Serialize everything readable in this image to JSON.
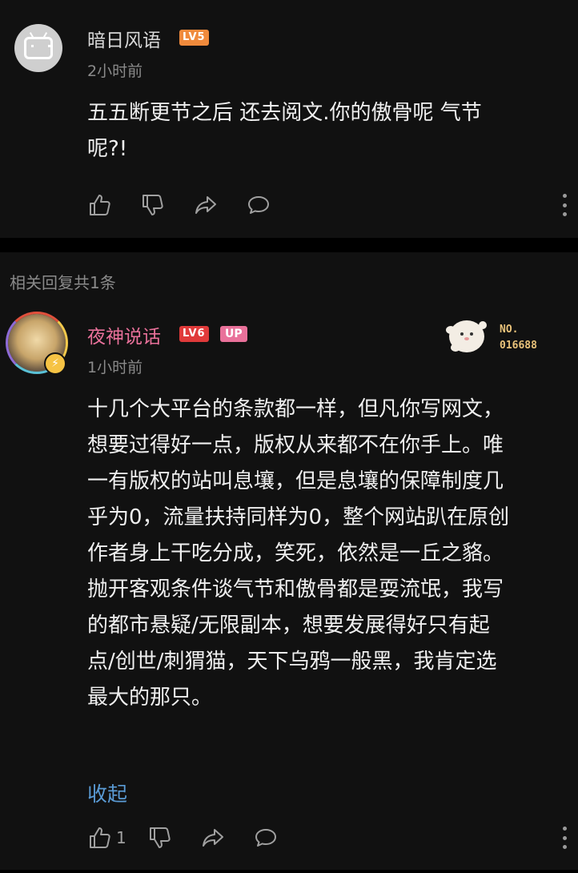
{
  "comment1": {
    "username": "暗日风语",
    "level": "LV5",
    "level_color": "#f08a3c",
    "time": "2小时前",
    "content": "五五断更节之后 还去阅文.你的傲骨呢 气节\n呢?!",
    "avatar_icon": "tv-icon"
  },
  "related": {
    "header": "相关回复共1条"
  },
  "comment2": {
    "username": "夜神说话",
    "username_color": "#e9719a",
    "level": "LV6",
    "level_color": "#e03a3a",
    "up_badge": "UP",
    "time": "1小时前",
    "fan_badge_no_label": "NO.",
    "fan_badge_number": "016688",
    "content": "十几个大平台的条款都一样，但凡你写网文，\n想要过得好一点，版权从来都不在你手上。唯\n一有版权的站叫息壤，但是息壤的保障制度几\n乎为0，流量扶持同样为0，整个网站趴在原创\n作者身上干吃分成，笑死，依然是一丘之貉。\n抛开客观条件谈气节和傲骨都是耍流氓，我写\n的都市悬疑/无限副本，想要发展得好只有起\n点/创世/刺猬猫，天下乌鸦一般黑，我肯定选\n最大的那只。",
    "collapse_label": "收起",
    "like_count": "1"
  }
}
